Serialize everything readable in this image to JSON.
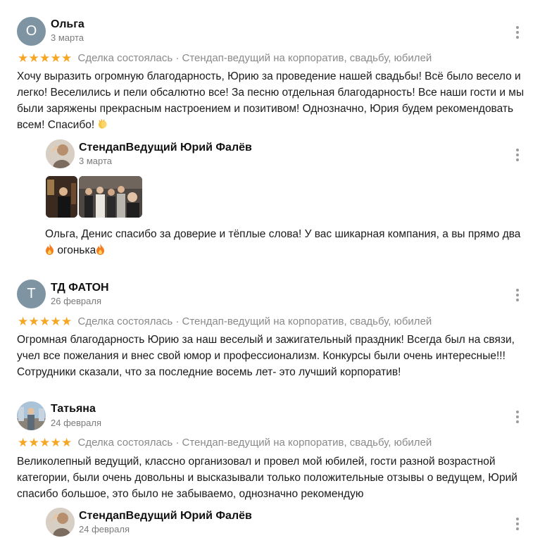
{
  "reviews": [
    {
      "author": "Ольга",
      "avatar_letter": "О",
      "date": "3 марта",
      "rating": 5,
      "meta": "Сделка состоялась · Стендап-ведущий на корпоратив, свадьбу, юбилей",
      "text": "Хочу выразить огромную благодарность, Юрию за проведение нашей свадьбы! Всё было весело и легко! Веселились и пели обсалютно все! За песню отдельная благодарность! Все наши гости и мы были заряжены прекрасным настроением и позитивом! Однозначно, Юрия будем рекомендовать всем! Спасибо!",
      "text_emoji": "clapping-hands",
      "reply": {
        "author": "СтендапВедущий Юрий Фалёв",
        "date": "3 марта",
        "text_part1": "Ольга, Денис спасибо за доверие и тёплые слова! У вас шикарная компания, а вы прямо два",
        "text_part2": "огонька",
        "emoji": "fire"
      }
    },
    {
      "author": "ТД ФАТОН",
      "avatar_letter": "Т",
      "date": "26 февраля",
      "rating": 5,
      "meta": "Сделка состоялась · Стендап-ведущий на корпоратив, свадьбу, юбилей",
      "text": "Огромная благодарность Юрию за наш веселый и зажигательный праздник! Всегда был на связи, учел все пожелания и внес свой юмор и профессионализм. Конкурсы были очень интересные!!! Сотрудники сказали, что за последние восемь лет- это лучший корпоратив!"
    },
    {
      "author": "Татьяна",
      "date": "24 февраля",
      "rating": 5,
      "meta": "Сделка состоялась · Стендап-ведущий на корпоратив, свадьбу, юбилей",
      "text": "Великолепный ведущий, классно организовал и провел мой юбилей, гости разной возрастной категории, были очень довольны и высказывали только положительные отзывы о ведущем, Юрий спасибо большое, это было не забываемо, однозначно рекомендую",
      "reply": {
        "author": "СтендапВедущий Юрий Фалёв",
        "date": "24 февраля"
      }
    }
  ],
  "colors": {
    "star": "#f5a623",
    "avatar_bg": "#7e94a2",
    "meta": "#8a8a8a"
  },
  "icons": {
    "menu": "kebab-menu-icon",
    "star": "star-icon"
  }
}
